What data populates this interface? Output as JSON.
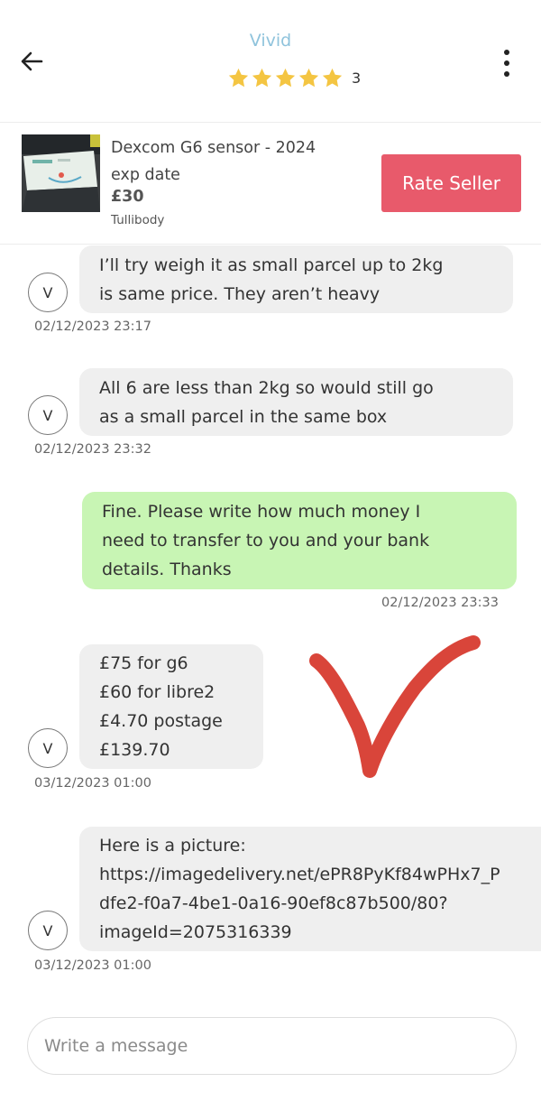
{
  "header": {
    "seller_name": "Vivid",
    "rating_count": "3",
    "stars": 5
  },
  "listing": {
    "title_line1": "Dexcom G6 sensor - 2024",
    "title_line2": "exp date",
    "price": "£30",
    "location": "Tullibody",
    "rate_button": "Rate Seller"
  },
  "messages": [
    {
      "direction": "incoming",
      "avatar": "V",
      "lines": [
        "I’ll try weigh it as small parcel up to 2kg",
        "is same price. They aren’t heavy"
      ],
      "timestamp": "02/12/2023 23:17"
    },
    {
      "direction": "incoming",
      "avatar": "V",
      "lines": [
        "All 6 are less than 2kg so would still go",
        "as a small parcel in the same box"
      ],
      "timestamp": "02/12/2023 23:32"
    },
    {
      "direction": "outgoing",
      "lines": [
        "Fine.  Please write how much money I",
        "need to transfer to you and your bank",
        "details.  Thanks"
      ],
      "timestamp": "02/12/2023 23:33"
    },
    {
      "direction": "incoming",
      "avatar": "V",
      "lines": [
        "£75 for g6",
        "£60 for libre2",
        "£4.70 postage",
        "£139.70"
      ],
      "timestamp": "03/12/2023 01:00"
    },
    {
      "direction": "incoming",
      "avatar": "V",
      "lines": [
        "Here is a picture:",
        "https://imagedelivery.net/ePR8PyKf84wPHx7_P",
        "dfe2-f0a7-4be1-0a16-90ef8c87b500/80?",
        "imageId=2075316339"
      ],
      "timestamp": "03/12/2023 01:00"
    }
  ],
  "composer": {
    "placeholder": "Write a message"
  },
  "colors": {
    "seller_name": "#8fc3dc",
    "star": "#f4c542",
    "rate_button": "#e85a6b",
    "incoming_bubble": "#efefef",
    "outgoing_bubble": "#c8f5b4",
    "checkmark": "#d9453a"
  },
  "icons": {
    "back": "arrow-left-icon",
    "more": "more-vertical-icon",
    "star": "star-icon"
  }
}
